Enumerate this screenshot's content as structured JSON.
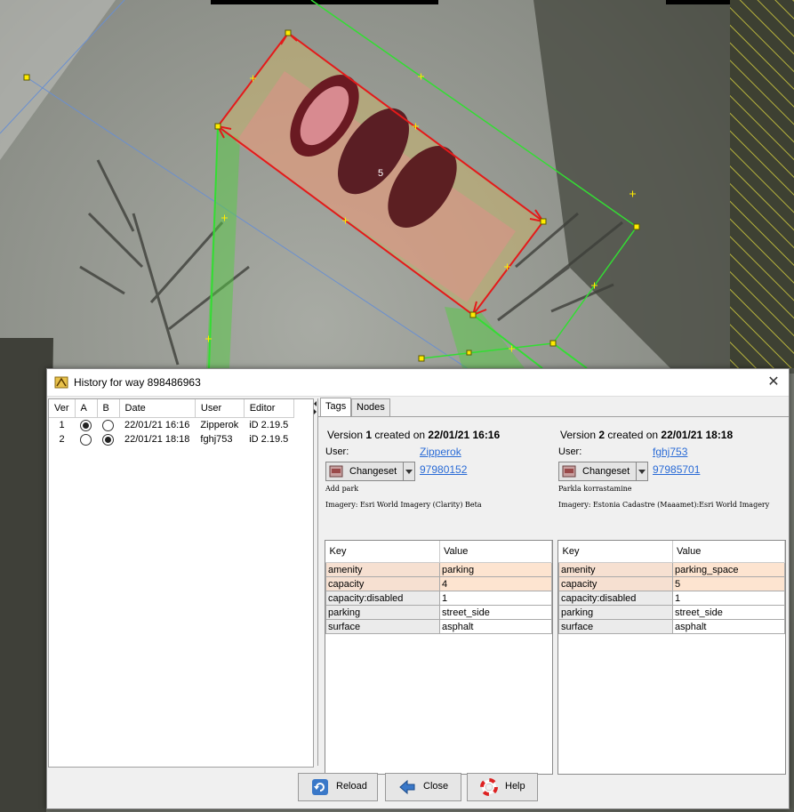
{
  "window": {
    "title": "History for way 898486963",
    "close_glyph": "✕"
  },
  "map": {
    "area_label": "5"
  },
  "versions_table": {
    "headers": [
      "Ver",
      "A",
      "B",
      "Date",
      "User",
      "Editor"
    ],
    "rows": [
      {
        "ver": "1",
        "a_selected": true,
        "b_selected": false,
        "date": "22/01/21 16:16",
        "user": "Zipperok",
        "editor": "iD 2.19.5"
      },
      {
        "ver": "2",
        "a_selected": false,
        "b_selected": true,
        "date": "22/01/21 18:18",
        "user": "fghj753",
        "editor": "iD 2.19.5"
      }
    ]
  },
  "tabs": [
    {
      "label": "Tags",
      "active": true
    },
    {
      "label": "Nodes",
      "active": false
    }
  ],
  "version_a": {
    "prefix": "Version ",
    "number": "1",
    "mid": " created on ",
    "date": "22/01/21 16:16",
    "user_label": "User:",
    "user": "Zipperok",
    "changeset_label": "Changeset",
    "changeset_id": "97980152",
    "comment": "Add park",
    "imagery_label": "Imagery:",
    "imagery": "Esri World Imagery (Clarity) Beta",
    "tag_headers": {
      "key": "Key",
      "value": "Value"
    },
    "tags": [
      {
        "key": "amenity",
        "value": "parking",
        "diff": true
      },
      {
        "key": "capacity",
        "value": "4",
        "diff": true
      },
      {
        "key": "capacity:disabled",
        "value": "1",
        "diff": false
      },
      {
        "key": "parking",
        "value": "street_side",
        "diff": false
      },
      {
        "key": "surface",
        "value": "asphalt",
        "diff": false
      }
    ]
  },
  "version_b": {
    "prefix": "Version ",
    "number": "2",
    "mid": " created on ",
    "date": "22/01/21 18:18",
    "user_label": "User:",
    "user": "fghj753",
    "changeset_label": "Changeset",
    "changeset_id": "97985701",
    "comment": "Parkla korrastamine",
    "imagery_label": "Imagery:",
    "imagery": "Estonia Cadastre (Maaamet):Esri World Imagery",
    "tag_headers": {
      "key": "Key",
      "value": "Value"
    },
    "tags": [
      {
        "key": "amenity",
        "value": "parking_space",
        "diff": true
      },
      {
        "key": "capacity",
        "value": "5",
        "diff": true
      },
      {
        "key": "capacity:disabled",
        "value": "1",
        "diff": false
      },
      {
        "key": "parking",
        "value": "street_side",
        "diff": false
      },
      {
        "key": "surface",
        "value": "asphalt",
        "diff": false
      }
    ]
  },
  "buttons": {
    "reload": "Reload",
    "close": "Close",
    "help": "Help"
  },
  "icons": {
    "title": "josm-logo-icon",
    "changeset": "changeset-icon",
    "reload": "reload-icon",
    "close": "close-arrow-icon",
    "help": "help-lifebuoy-icon"
  },
  "colors": {
    "selection": "#e41a1a",
    "parking_fill": "#c8b36b",
    "link": "#2a6bd6",
    "diff_highlight": "#fde4d0",
    "way_green": "#33dd33"
  }
}
